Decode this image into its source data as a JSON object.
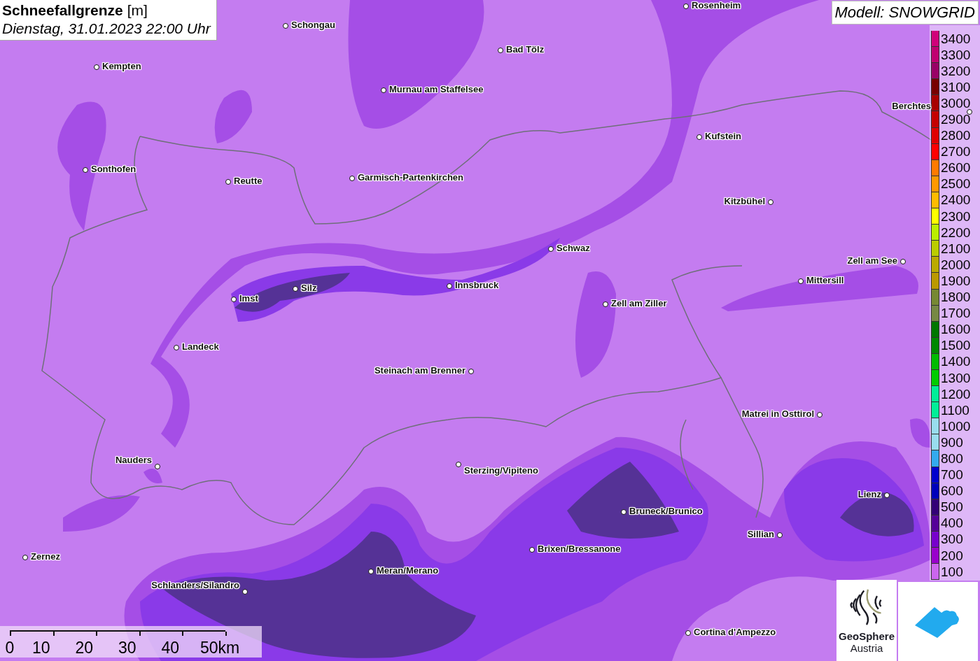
{
  "title": {
    "name": "Schneefallgrenze",
    "unit": "[m]",
    "datetime": "Dienstag, 31.01.2023 22:00 Uhr"
  },
  "model": "Modell: SNOWGRID",
  "places": [
    {
      "name": "Schongau"
    },
    {
      "name": "Rosenheim"
    },
    {
      "name": "Bad Tölz"
    },
    {
      "name": "Kempten"
    },
    {
      "name": "Murnau am Staffelsee"
    },
    {
      "name": "Berchtes"
    },
    {
      "name": "Kufstein"
    },
    {
      "name": "Sonthofen"
    },
    {
      "name": "Reutte"
    },
    {
      "name": "Garmisch-Partenkirchen"
    },
    {
      "name": "Kitzbühel"
    },
    {
      "name": "Schwaz"
    },
    {
      "name": "Zell am See"
    },
    {
      "name": "Mittersill"
    },
    {
      "name": "Silz"
    },
    {
      "name": "Innsbruck"
    },
    {
      "name": "Imst"
    },
    {
      "name": "Zell am Ziller"
    },
    {
      "name": "Landeck"
    },
    {
      "name": "Steinach am Brenner"
    },
    {
      "name": "Matrei in Osttirol"
    },
    {
      "name": "Nauders"
    },
    {
      "name": "Sterzing/Vipiteno"
    },
    {
      "name": "Lienz"
    },
    {
      "name": "Bruneck/Brunico"
    },
    {
      "name": "Sillian"
    },
    {
      "name": "Brixen/Bressanone"
    },
    {
      "name": "Zernez"
    },
    {
      "name": "Meran/Merano"
    },
    {
      "name": "Schlanders/Silandro"
    },
    {
      "name": "Cortina d'Ampezzo"
    }
  ],
  "legend": [
    {
      "label": "3400",
      "color": "#d0007a"
    },
    {
      "label": "3300",
      "color": "#c00070"
    },
    {
      "label": "3200",
      "color": "#990066"
    },
    {
      "label": "3100",
      "color": "#780000"
    },
    {
      "label": "3000",
      "color": "#a80000"
    },
    {
      "label": "2900",
      "color": "#c40000"
    },
    {
      "label": "2800",
      "color": "#e00000"
    },
    {
      "label": "2700",
      "color": "#ff0000"
    },
    {
      "label": "2600",
      "color": "#ff7a00"
    },
    {
      "label": "2500",
      "color": "#ff9900"
    },
    {
      "label": "2400",
      "color": "#ffbb00"
    },
    {
      "label": "2300",
      "color": "#ffff00"
    },
    {
      "label": "2200",
      "color": "#bbee00"
    },
    {
      "label": "2100",
      "color": "#bbcc00"
    },
    {
      "label": "2000",
      "color": "#bbaa00"
    },
    {
      "label": "1900",
      "color": "#bb9900"
    },
    {
      "label": "1800",
      "color": "#778833"
    },
    {
      "label": "1700",
      "color": "#778844"
    },
    {
      "label": "1600",
      "color": "#007700"
    },
    {
      "label": "1500",
      "color": "#008800"
    },
    {
      "label": "1400",
      "color": "#00bb00"
    },
    {
      "label": "1300",
      "color": "#00cc00"
    },
    {
      "label": "1200",
      "color": "#00ee99"
    },
    {
      "label": "1100",
      "color": "#00ee98"
    },
    {
      "label": "1000",
      "color": "#99ddee"
    },
    {
      "label": "900",
      "color": "#99ddef"
    },
    {
      "label": "800",
      "color": "#33aaee"
    },
    {
      "label": "700",
      "color": "#0000cc"
    },
    {
      "label": "600",
      "color": "#0000bb"
    },
    {
      "label": "500",
      "color": "#330077"
    },
    {
      "label": "400",
      "color": "#550099"
    },
    {
      "label": "300",
      "color": "#7700cc"
    },
    {
      "label": "200",
      "color": "#9900cc"
    },
    {
      "label": "100",
      "color": "#cc66ee"
    }
  ],
  "scale": {
    "ticks": [
      "0",
      "10",
      "20",
      "30",
      "40",
      "50km"
    ]
  },
  "logos": {
    "name": "GeoSphere",
    "sub": "Austria"
  }
}
